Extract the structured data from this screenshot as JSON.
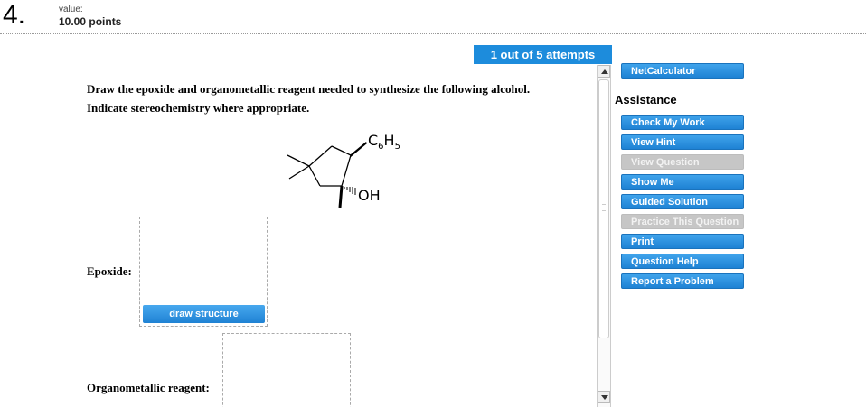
{
  "header": {
    "question_number": "4.",
    "value_label": "value:",
    "points": "10.00 points"
  },
  "attempts": "1 out of 5 attempts",
  "question": {
    "line1": "Draw the epoxide and organometallic reagent needed to synthesize the following alcohol.",
    "line2": "Indicate stereochemistry where appropriate.",
    "molecule": {
      "substituent1": "C",
      "substituent1_sub": "6",
      "substituent1_rest": "H",
      "substituent1_sub2": "5",
      "substituent2": "OH"
    }
  },
  "answers": {
    "epoxide_label": "Epoxide:",
    "draw_button": "draw structure",
    "organometallic_label": "Organometallic reagent:"
  },
  "sidebar": {
    "netcalc": "NetCalculator",
    "assistance_title": "Assistance",
    "buttons": [
      {
        "label": "Check My Work",
        "enabled": true
      },
      {
        "label": "View Hint",
        "enabled": true
      },
      {
        "label": "View Question",
        "enabled": false
      },
      {
        "label": "Show Me",
        "enabled": true
      },
      {
        "label": "Guided Solution",
        "enabled": true
      },
      {
        "label": "Practice This Question",
        "enabled": false
      },
      {
        "label": "Print",
        "enabled": true
      },
      {
        "label": "Question Help",
        "enabled": true
      },
      {
        "label": "Report a Problem",
        "enabled": true
      }
    ]
  },
  "colors": {
    "accent": "#1d8cdc",
    "disabled": "#c6c6c6"
  }
}
